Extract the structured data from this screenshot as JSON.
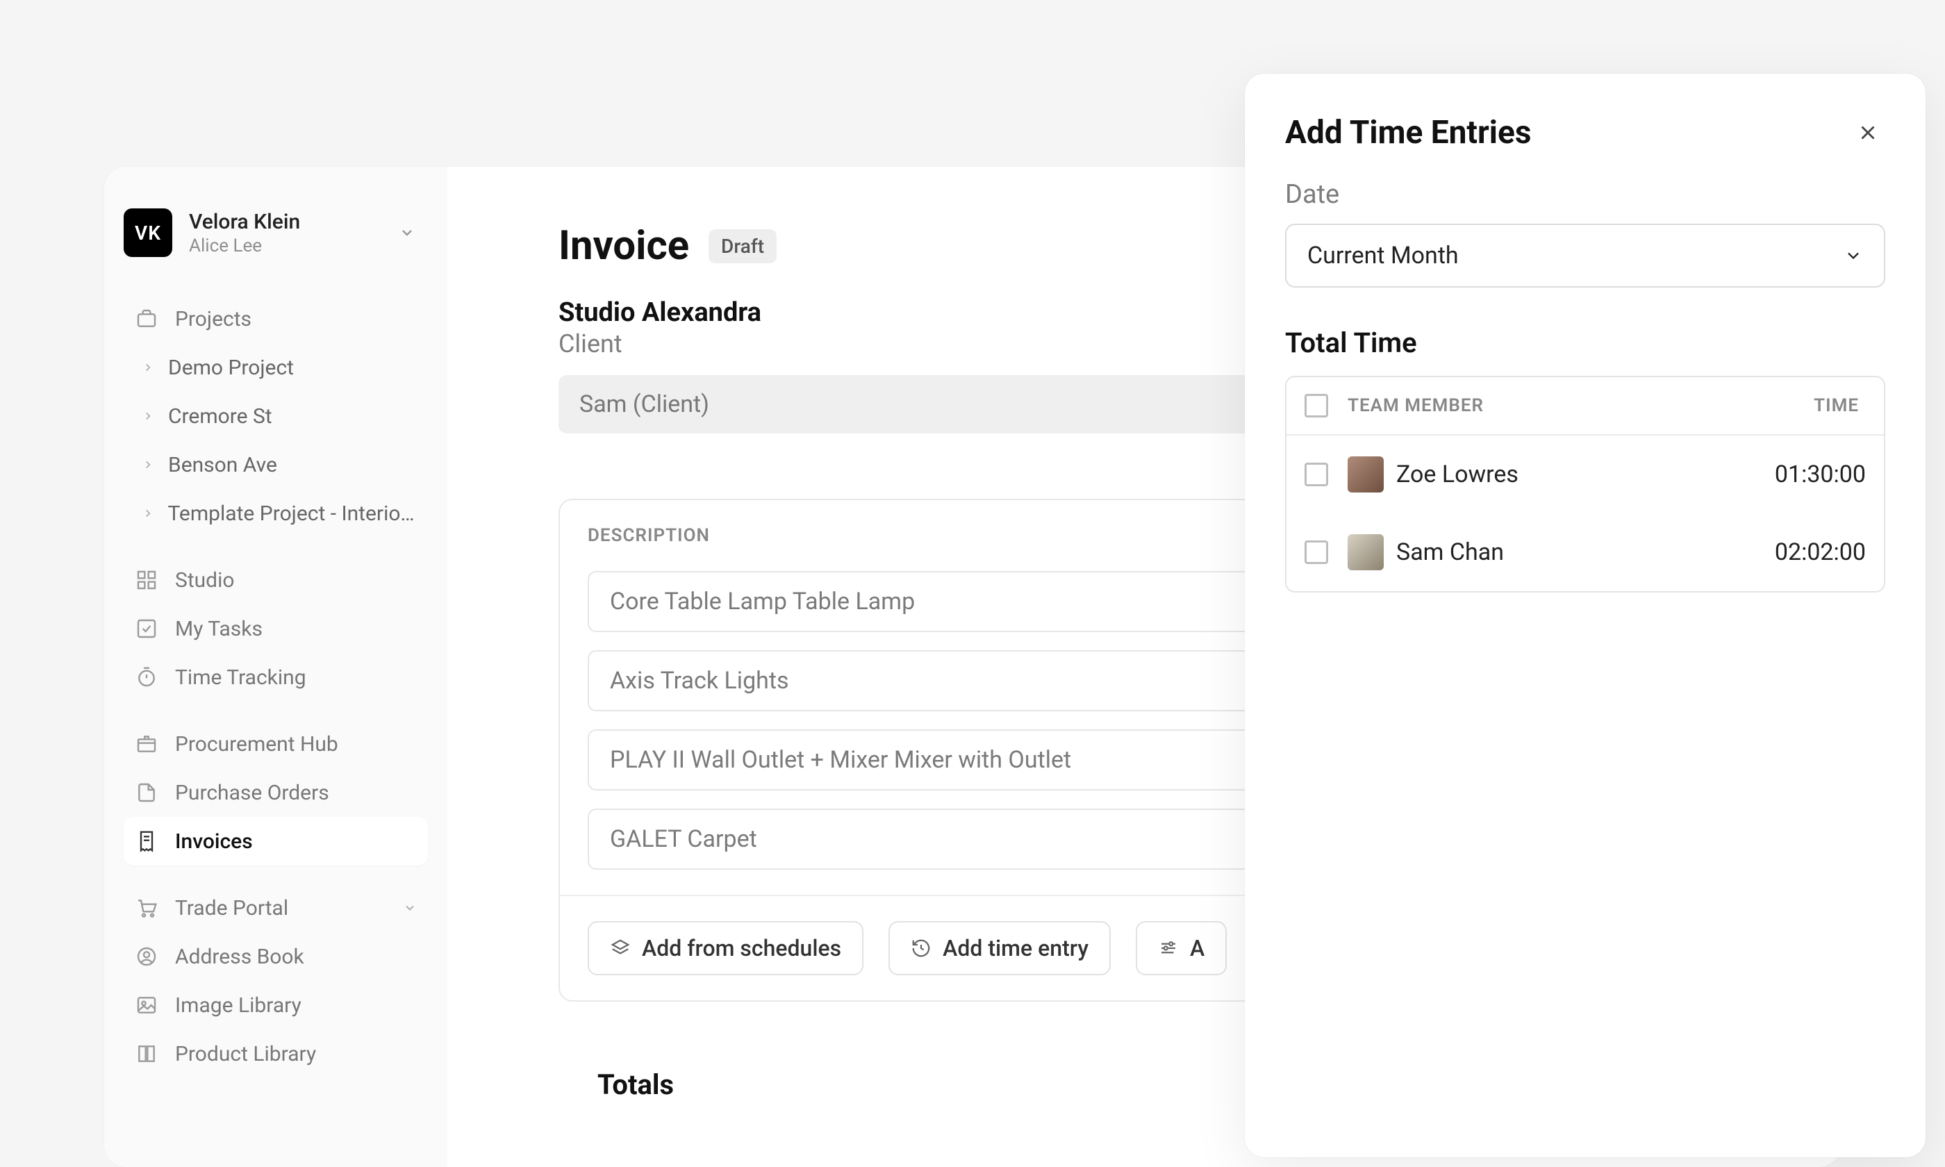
{
  "org": {
    "logo_initials": "VK",
    "name": "Velora Klein",
    "user": "Alice Lee"
  },
  "sidebar": {
    "projects_label": "Projects",
    "projects": [
      {
        "label": "Demo Project"
      },
      {
        "label": "Cremore St"
      },
      {
        "label": "Benson Ave"
      },
      {
        "label": "Template Project - Interior..."
      }
    ],
    "items": [
      {
        "label": "Studio"
      },
      {
        "label": "My Tasks"
      },
      {
        "label": "Time Tracking"
      },
      {
        "label": "Procurement Hub"
      },
      {
        "label": "Purchase Orders"
      },
      {
        "label": "Invoices"
      },
      {
        "label": "Trade Portal"
      },
      {
        "label": "Address Book"
      },
      {
        "label": "Image Library"
      },
      {
        "label": "Product Library"
      }
    ]
  },
  "invoice": {
    "title": "Invoice",
    "badge": "Draft",
    "client_name": "Studio Alexandra",
    "client_role": "Client",
    "client_contact": "Sam (Client)",
    "desc_header": "DESCRIPTION",
    "lines": [
      "Core Table Lamp Table Lamp",
      "Axis Track Lights",
      "PLAY II Wall Outlet + Mixer Mixer with Outlet",
      "GALET Carpet"
    ],
    "actions": {
      "from_schedules": "Add from schedules",
      "time_entry": "Add time entry",
      "third_partial": "A"
    },
    "totals_label": "Totals"
  },
  "panel": {
    "title": "Add Time Entries",
    "date_label": "Date",
    "date_value": "Current Month",
    "total_time_label": "Total Time",
    "columns": {
      "member": "TEAM MEMBER",
      "time": "TIME"
    },
    "rows": [
      {
        "name": "Zoe Lowres",
        "time": "01:30:00"
      },
      {
        "name": "Sam Chan",
        "time": "02:02:00"
      }
    ]
  }
}
